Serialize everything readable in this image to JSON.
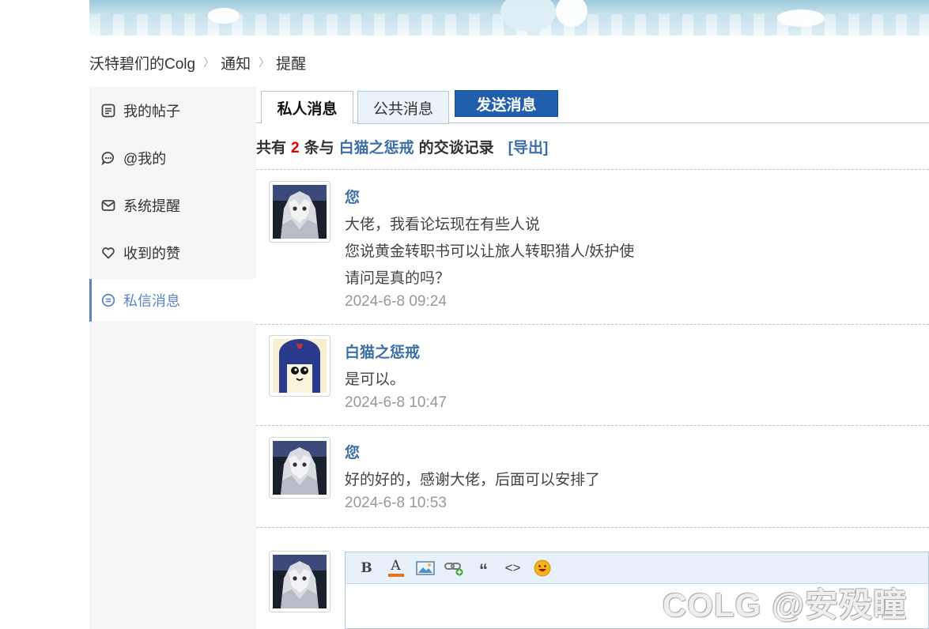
{
  "breadcrumb": {
    "items": [
      "沃特碧们的Colg",
      "通知",
      "提醒"
    ],
    "separator": "〉"
  },
  "sidebar": {
    "items": [
      {
        "label": "我的帖子",
        "icon": "post-icon"
      },
      {
        "label": "@我的",
        "icon": "mention-icon"
      },
      {
        "label": "系统提醒",
        "icon": "mail-icon"
      },
      {
        "label": "收到的赞",
        "icon": "heart-icon"
      },
      {
        "label": "私信消息",
        "icon": "message-icon",
        "active": true
      }
    ]
  },
  "tabs": {
    "private": "私人消息",
    "public": "公共消息",
    "send": "发送消息"
  },
  "summary": {
    "prefix": "共有",
    "count": "2",
    "mid": "条与",
    "partner": "白猫之惩戒",
    "suffix": "的交谈记录",
    "export": "[导出]"
  },
  "messages": [
    {
      "author": "您",
      "lines": [
        "大佬，我看论坛现在有些人说",
        "您说黄金转职书可以让旅人转职猎人/妖护使",
        "请问是真的吗？"
      ],
      "time": "2024-6-8 09:24"
    },
    {
      "author": "白猫之惩戒",
      "lines": [
        "是可以。"
      ],
      "time": "2024-6-8 10:47"
    },
    {
      "author": "您",
      "lines": [
        "好的好的，感谢大佬，后面可以安排了"
      ],
      "time": "2024-6-8 10:53"
    }
  ],
  "editor": {
    "tools": [
      "bold-icon",
      "font-color-icon",
      "image-icon",
      "link-icon",
      "quote-icon",
      "code-icon",
      "emoji-icon"
    ],
    "bold_glyph": "B",
    "color_glyph": "A",
    "quote_glyph": "“",
    "code_glyph": "<>"
  },
  "watermark": "COLG @安殁瞳",
  "colors": {
    "link": "#3c6fa8",
    "accent": "#5b86c2",
    "send_button": "#1f5fae",
    "count": "#e00000"
  }
}
